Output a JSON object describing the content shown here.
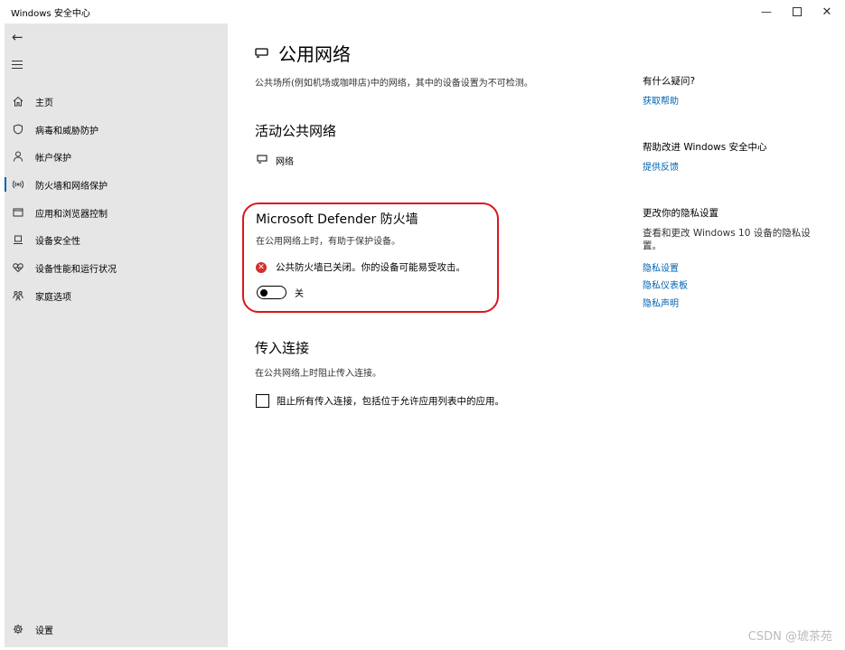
{
  "window": {
    "title": "Windows 安全中心",
    "minimize_icon": "—",
    "close_icon": "✕"
  },
  "sidebar": {
    "back_icon": "←",
    "items": [
      {
        "label": "主页",
        "icon": "home-icon"
      },
      {
        "label": "病毒和威胁防护",
        "icon": "shield-icon"
      },
      {
        "label": "帐户保护",
        "icon": "person-icon"
      },
      {
        "label": "防火墙和网络保护",
        "icon": "antenna-icon",
        "active": true
      },
      {
        "label": "应用和浏览器控制",
        "icon": "browser-window-icon"
      },
      {
        "label": "设备安全性",
        "icon": "device-icon"
      },
      {
        "label": "设备性能和运行状况",
        "icon": "heart-icon"
      },
      {
        "label": "家庭选项",
        "icon": "family-icon"
      }
    ],
    "settings_label": "设置"
  },
  "main": {
    "title": "公用网络",
    "description": "公共场所(例如机场或咖啡店)中的网络，其中的设备设置为不可检测。",
    "active_networks": {
      "title": "活动公共网络",
      "network_name": "网络"
    },
    "firewall": {
      "title": "Microsoft Defender 防火墙",
      "description": "在公用网络上时，有助于保护设备。",
      "warning": "公共防火墙已关闭。你的设备可能易受攻击。",
      "warning_icon": "✕",
      "toggle_label": "关",
      "toggle_on": false
    },
    "incoming": {
      "title": "传入连接",
      "description": "在公共网络上时阻止传入连接。",
      "checkbox_label": "阻止所有传入连接，包括位于允许应用列表中的应用。",
      "checked": false
    }
  },
  "right": {
    "help_heading": "有什么疑问?",
    "help_link": "获取帮助",
    "improve_heading": "帮助改进 Windows 安全中心",
    "feedback_link": "提供反馈",
    "privacy_heading": "更改你的隐私设置",
    "privacy_text": "查看和更改 Windows 10 设备的隐私设置。",
    "privacy_links": [
      "隐私设置",
      "隐私仪表板",
      "隐私声明"
    ]
  },
  "watermark": "CSDN @琥茶苑",
  "colors": {
    "accent": "#0063b1",
    "highlight_border": "#d9171b",
    "error": "#d32f2f",
    "sidebar_bg": "#e6e6e6"
  }
}
